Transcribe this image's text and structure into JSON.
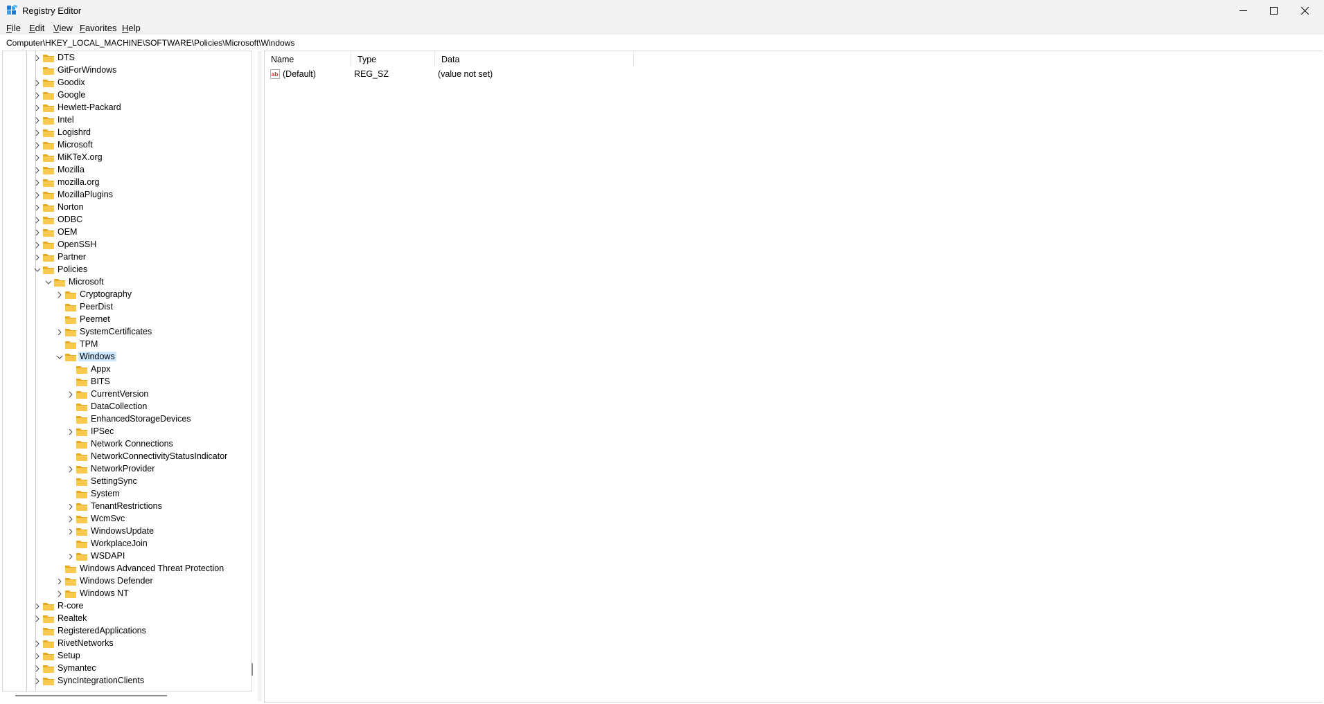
{
  "window": {
    "title": "Registry Editor",
    "controls": {
      "minimize": "minimize",
      "maximize": "maximize",
      "close": "close"
    }
  },
  "menu": [
    {
      "underline": "F",
      "rest": "ile"
    },
    {
      "underline": "E",
      "rest": "dit"
    },
    {
      "underline": "V",
      "rest": "iew"
    },
    {
      "underline": "F",
      "rest": "avorites"
    },
    {
      "underline": "H",
      "rest": "elp"
    }
  ],
  "address": "Computer\\HKEY_LOCAL_MACHINE\\SOFTWARE\\Policies\\Microsoft\\Windows",
  "tree": [
    {
      "label": "DTS",
      "level": 0,
      "expander": "collapsed"
    },
    {
      "label": "GitForWindows",
      "level": 0,
      "expander": "none"
    },
    {
      "label": "Goodix",
      "level": 0,
      "expander": "collapsed"
    },
    {
      "label": "Google",
      "level": 0,
      "expander": "collapsed"
    },
    {
      "label": "Hewlett-Packard",
      "level": 0,
      "expander": "collapsed"
    },
    {
      "label": "Intel",
      "level": 0,
      "expander": "collapsed"
    },
    {
      "label": "Logishrd",
      "level": 0,
      "expander": "collapsed"
    },
    {
      "label": "Microsoft",
      "level": 0,
      "expander": "collapsed"
    },
    {
      "label": "MiKTeX.org",
      "level": 0,
      "expander": "collapsed"
    },
    {
      "label": "Mozilla",
      "level": 0,
      "expander": "collapsed"
    },
    {
      "label": "mozilla.org",
      "level": 0,
      "expander": "collapsed"
    },
    {
      "label": "MozillaPlugins",
      "level": 0,
      "expander": "collapsed"
    },
    {
      "label": "Norton",
      "level": 0,
      "expander": "collapsed"
    },
    {
      "label": "ODBC",
      "level": 0,
      "expander": "collapsed"
    },
    {
      "label": "OEM",
      "level": 0,
      "expander": "collapsed"
    },
    {
      "label": "OpenSSH",
      "level": 0,
      "expander": "collapsed"
    },
    {
      "label": "Partner",
      "level": 0,
      "expander": "collapsed"
    },
    {
      "label": "Policies",
      "level": 0,
      "expander": "expanded"
    },
    {
      "label": "Microsoft",
      "level": 1,
      "expander": "expanded"
    },
    {
      "label": "Cryptography",
      "level": 2,
      "expander": "collapsed"
    },
    {
      "label": "PeerDist",
      "level": 2,
      "expander": "none"
    },
    {
      "label": "Peernet",
      "level": 2,
      "expander": "none"
    },
    {
      "label": "SystemCertificates",
      "level": 2,
      "expander": "collapsed"
    },
    {
      "label": "TPM",
      "level": 2,
      "expander": "none"
    },
    {
      "label": "Windows",
      "level": 2,
      "expander": "expanded",
      "selected": true
    },
    {
      "label": "Appx",
      "level": 3,
      "expander": "none"
    },
    {
      "label": "BITS",
      "level": 3,
      "expander": "none"
    },
    {
      "label": "CurrentVersion",
      "level": 3,
      "expander": "collapsed"
    },
    {
      "label": "DataCollection",
      "level": 3,
      "expander": "none"
    },
    {
      "label": "EnhancedStorageDevices",
      "level": 3,
      "expander": "none"
    },
    {
      "label": "IPSec",
      "level": 3,
      "expander": "collapsed"
    },
    {
      "label": "Network Connections",
      "level": 3,
      "expander": "none"
    },
    {
      "label": "NetworkConnectivityStatusIndicator",
      "level": 3,
      "expander": "none"
    },
    {
      "label": "NetworkProvider",
      "level": 3,
      "expander": "collapsed"
    },
    {
      "label": "SettingSync",
      "level": 3,
      "expander": "none"
    },
    {
      "label": "System",
      "level": 3,
      "expander": "none"
    },
    {
      "label": "TenantRestrictions",
      "level": 3,
      "expander": "collapsed"
    },
    {
      "label": "WcmSvc",
      "level": 3,
      "expander": "collapsed"
    },
    {
      "label": "WindowsUpdate",
      "level": 3,
      "expander": "collapsed"
    },
    {
      "label": "WorkplaceJoin",
      "level": 3,
      "expander": "none"
    },
    {
      "label": "WSDAPI",
      "level": 3,
      "expander": "collapsed"
    },
    {
      "label": "Windows Advanced Threat Protection",
      "level": 2,
      "expander": "none"
    },
    {
      "label": "Windows Defender",
      "level": 2,
      "expander": "collapsed"
    },
    {
      "label": "Windows NT",
      "level": 2,
      "expander": "collapsed"
    },
    {
      "label": "R-core",
      "level": 0,
      "expander": "collapsed"
    },
    {
      "label": "Realtek",
      "level": 0,
      "expander": "collapsed"
    },
    {
      "label": "RegisteredApplications",
      "level": 0,
      "expander": "none"
    },
    {
      "label": "RivetNetworks",
      "level": 0,
      "expander": "collapsed"
    },
    {
      "label": "Setup",
      "level": 0,
      "expander": "collapsed"
    },
    {
      "label": "Symantec",
      "level": 0,
      "expander": "collapsed"
    },
    {
      "label": "SyncIntegrationClients",
      "level": 0,
      "expander": "collapsed"
    }
  ],
  "list": {
    "columns": [
      "Name",
      "Type",
      "Data"
    ],
    "rows": [
      {
        "name": "(Default)",
        "type": "REG_SZ",
        "data": "(value not set)",
        "icon": "string-value-icon"
      }
    ]
  },
  "colors": {
    "selection": "#cce8ff",
    "folder": "#f8c94e",
    "folder_back": "#e9a820",
    "chrome": "#f3f3f3"
  }
}
